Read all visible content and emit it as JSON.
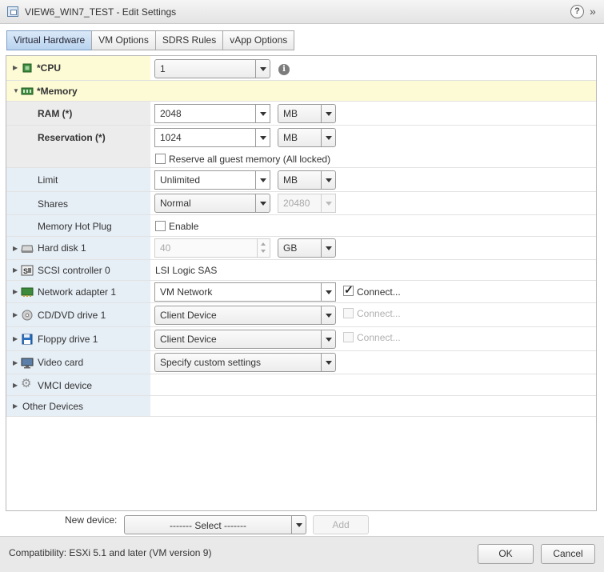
{
  "window": {
    "title": "VIEW6_WIN7_TEST - Edit Settings",
    "help_label": "?",
    "expand_label": "»"
  },
  "tabs": [
    {
      "label": "Virtual Hardware",
      "active": true
    },
    {
      "label": "VM Options",
      "active": false
    },
    {
      "label": "SDRS Rules",
      "active": false
    },
    {
      "label": "vApp Options",
      "active": false
    }
  ],
  "hardware": {
    "cpu": {
      "label": "*CPU",
      "value": "1"
    },
    "memory": {
      "label": "*Memory",
      "ram": {
        "label": "RAM (*)",
        "value": "2048",
        "unit": "MB"
      },
      "reservation": {
        "label": "Reservation (*)",
        "value": "1024",
        "unit": "MB",
        "reserve_all_label": "Reserve all guest memory (All locked)",
        "reserve_all_checked": false
      },
      "limit": {
        "label": "Limit",
        "value": "Unlimited",
        "unit": "MB"
      },
      "shares": {
        "label": "Shares",
        "value": "Normal",
        "amount": "20480"
      },
      "hot_plug": {
        "label": "Memory Hot Plug",
        "enable_label": "Enable",
        "checked": false
      }
    },
    "hard_disk": {
      "label": "Hard disk 1",
      "value": "40",
      "unit": "GB"
    },
    "scsi": {
      "label": "SCSI controller 0",
      "value": "LSI Logic SAS"
    },
    "network": {
      "label": "Network adapter 1",
      "value": "VM Network",
      "connect_label": "Connect...",
      "connected": true
    },
    "cdrom": {
      "label": "CD/DVD drive 1",
      "value": "Client Device",
      "connect_label": "Connect...",
      "connected": false
    },
    "floppy": {
      "label": "Floppy drive 1",
      "value": "Client Device",
      "connect_label": "Connect...",
      "connected": false
    },
    "video": {
      "label": "Video card",
      "value": "Specify custom settings"
    },
    "vmci": {
      "label": "VMCI device"
    },
    "other": {
      "label": "Other Devices"
    }
  },
  "new_device": {
    "label": "New device:",
    "select_value": "------- Select -------",
    "add_label": "Add"
  },
  "footer": {
    "compatibility": "Compatibility: ESXi 5.1 and later (VM version 9)",
    "ok_label": "OK",
    "cancel_label": "Cancel"
  },
  "icons": {
    "cpu": "cpu-chip-icon",
    "memory": "memory-module-icon",
    "hard_disk": "hard-disk-icon",
    "scsi": "scsi-controller-icon",
    "network": "network-adapter-icon",
    "cdrom": "cd-dvd-icon",
    "floppy": "floppy-disk-icon",
    "video": "monitor-icon",
    "vmci": "gear-icon",
    "info": "info-icon"
  }
}
